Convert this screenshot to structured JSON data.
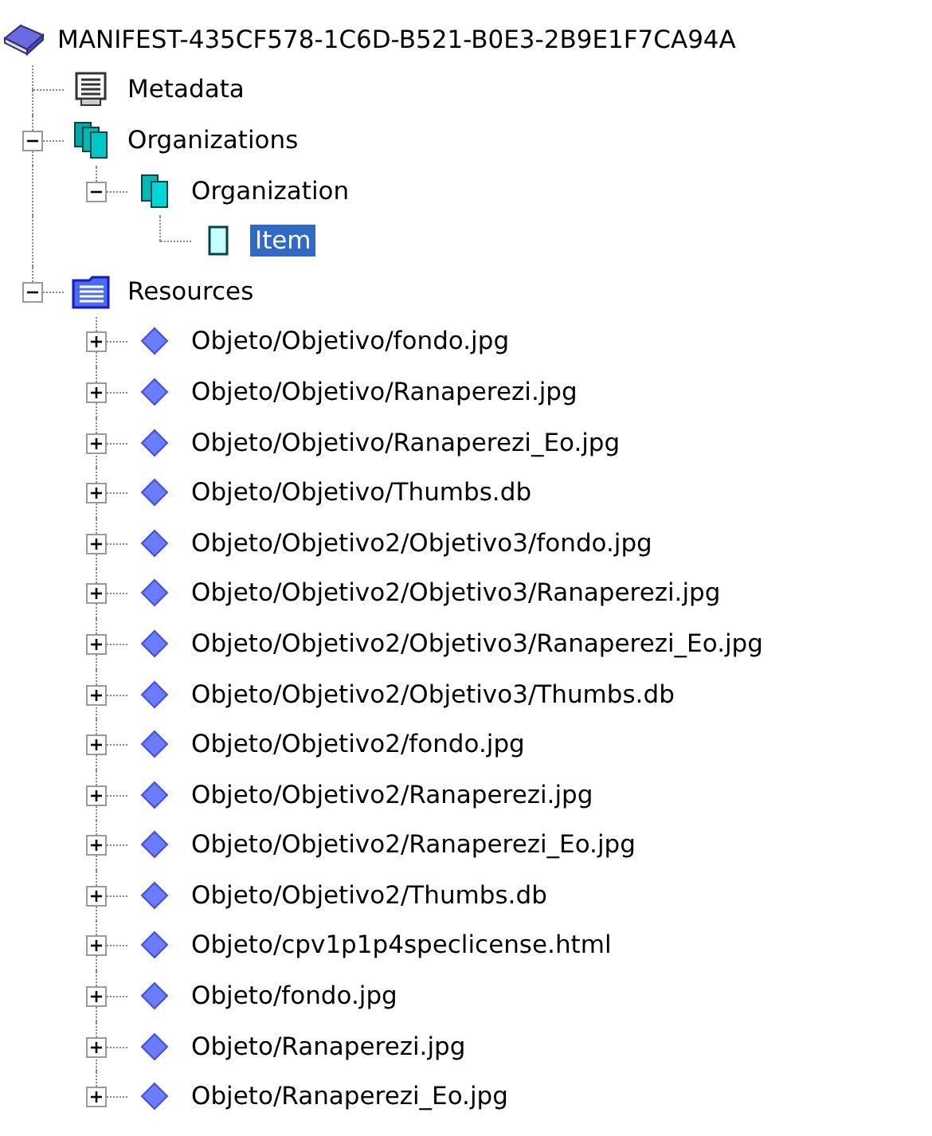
{
  "tree": {
    "label": "MANIFEST-435CF578-1C6D-B521-B0E3-2B9E1F7CA94A",
    "kind": "manifest",
    "selected": false,
    "children": [
      {
        "label": "Metadata",
        "kind": "metadata",
        "selected": false
      },
      {
        "label": "Organizations",
        "kind": "organizations",
        "selected": false,
        "expanded": true,
        "children": [
          {
            "label": "Organization",
            "kind": "organization",
            "selected": false,
            "expanded": true,
            "children": [
              {
                "label": "Item",
                "kind": "item",
                "selected": true
              }
            ]
          }
        ]
      },
      {
        "label": "Resources",
        "kind": "resources",
        "selected": false,
        "expanded": true,
        "children": [
          {
            "label": "Objeto/Objetivo/fondo.jpg",
            "kind": "resource",
            "selected": false,
            "expanded": false
          },
          {
            "label": "Objeto/Objetivo/Ranaperezi.jpg",
            "kind": "resource",
            "selected": false,
            "expanded": false
          },
          {
            "label": "Objeto/Objetivo/Ranaperezi_Eo.jpg",
            "kind": "resource",
            "selected": false,
            "expanded": false
          },
          {
            "label": "Objeto/Objetivo/Thumbs.db",
            "kind": "resource",
            "selected": false,
            "expanded": false
          },
          {
            "label": "Objeto/Objetivo2/Objetivo3/fondo.jpg",
            "kind": "resource",
            "selected": false,
            "expanded": false
          },
          {
            "label": "Objeto/Objetivo2/Objetivo3/Ranaperezi.jpg",
            "kind": "resource",
            "selected": false,
            "expanded": false
          },
          {
            "label": "Objeto/Objetivo2/Objetivo3/Ranaperezi_Eo.jpg",
            "kind": "resource",
            "selected": false,
            "expanded": false
          },
          {
            "label": "Objeto/Objetivo2/Objetivo3/Thumbs.db",
            "kind": "resource",
            "selected": false,
            "expanded": false
          },
          {
            "label": "Objeto/Objetivo2/fondo.jpg",
            "kind": "resource",
            "selected": false,
            "expanded": false
          },
          {
            "label": "Objeto/Objetivo2/Ranaperezi.jpg",
            "kind": "resource",
            "selected": false,
            "expanded": false
          },
          {
            "label": "Objeto/Objetivo2/Ranaperezi_Eo.jpg",
            "kind": "resource",
            "selected": false,
            "expanded": false
          },
          {
            "label": "Objeto/Objetivo2/Thumbs.db",
            "kind": "resource",
            "selected": false,
            "expanded": false
          },
          {
            "label": "Objeto/cpv1p1p4speclicense.html",
            "kind": "resource",
            "selected": false,
            "expanded": false
          },
          {
            "label": "Objeto/fondo.jpg",
            "kind": "resource",
            "selected": false,
            "expanded": false
          },
          {
            "label": "Objeto/Ranaperezi.jpg",
            "kind": "resource",
            "selected": false,
            "expanded": false
          },
          {
            "label": "Objeto/Ranaperezi_Eo.jpg",
            "kind": "resource",
            "selected": false,
            "expanded": false
          }
        ]
      }
    ]
  }
}
